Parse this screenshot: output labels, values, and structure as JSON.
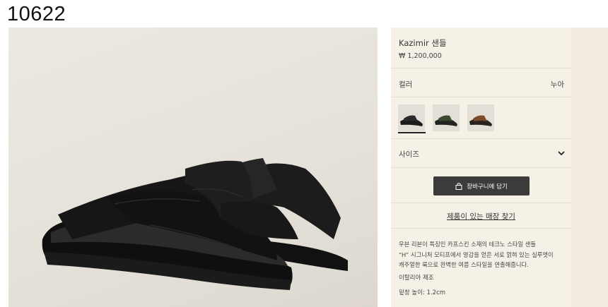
{
  "page_id": "10622",
  "product": {
    "name": "Kazimir 샌들",
    "price": "₩ 1,200,000",
    "color_label": "컬러",
    "color_value": "누아",
    "swatches": [
      {
        "name": "black",
        "strap": "#1b1b1b",
        "base": "#2a2a2a"
      },
      {
        "name": "dark-green",
        "strap": "#3a4a33",
        "base": "#222"
      },
      {
        "name": "brown",
        "strap": "#7a4a2c",
        "base": "#2a221e"
      }
    ],
    "selected_swatch_index": 0,
    "size_label": "사이즈",
    "cart_label": "장바구니에 담기",
    "store_link": "제품이 있는 매장 찾기",
    "description": [
      "우븐 리본이 특징인 카프스킨 소재의 테크노 스타일 샌들",
      "“H” 시그니처 모티프에서 영감을 얻은 서로 얽혀 있는 실루엣이",
      "캐주얼한 룩으로 완벽한 여름 스타일을 연출해줍니다."
    ],
    "origin": "이탈리아 제조",
    "heel_height": "밑창 높이: 1.2cm"
  },
  "colors": {
    "panel_bg": "#f6f1e7",
    "button_bg": "#3b3b3b",
    "photo_bg": "#e8e4dd",
    "sandal": "#1a1a1a"
  }
}
